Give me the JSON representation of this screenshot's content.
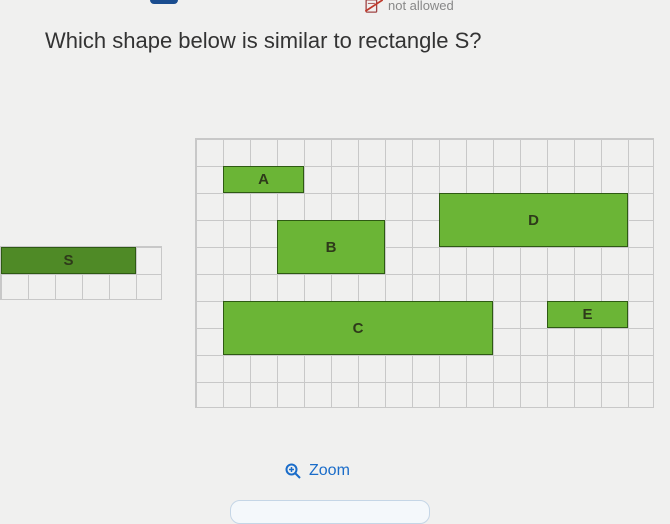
{
  "banner": {
    "label": ""
  },
  "not_allowed": {
    "text": "not allowed"
  },
  "question": {
    "text": "Which shape below is similar to rectangle S?"
  },
  "shapes": {
    "s": "S",
    "a": "A",
    "b": "B",
    "c": "C",
    "d": "D",
    "e": "E"
  },
  "zoom": {
    "label": "Zoom"
  },
  "chart_data": {
    "type": "table",
    "title": "Rectangles on grid – similarity question",
    "unit": "grid squares",
    "reference": {
      "name": "S",
      "width": 5,
      "height": 1
    },
    "options": [
      {
        "name": "A",
        "width": 3,
        "height": 1
      },
      {
        "name": "B",
        "width": 4,
        "height": 2
      },
      {
        "name": "C",
        "width": 10,
        "height": 2
      },
      {
        "name": "D",
        "width": 7,
        "height": 2
      },
      {
        "name": "E",
        "width": 3,
        "height": 1
      }
    ]
  }
}
